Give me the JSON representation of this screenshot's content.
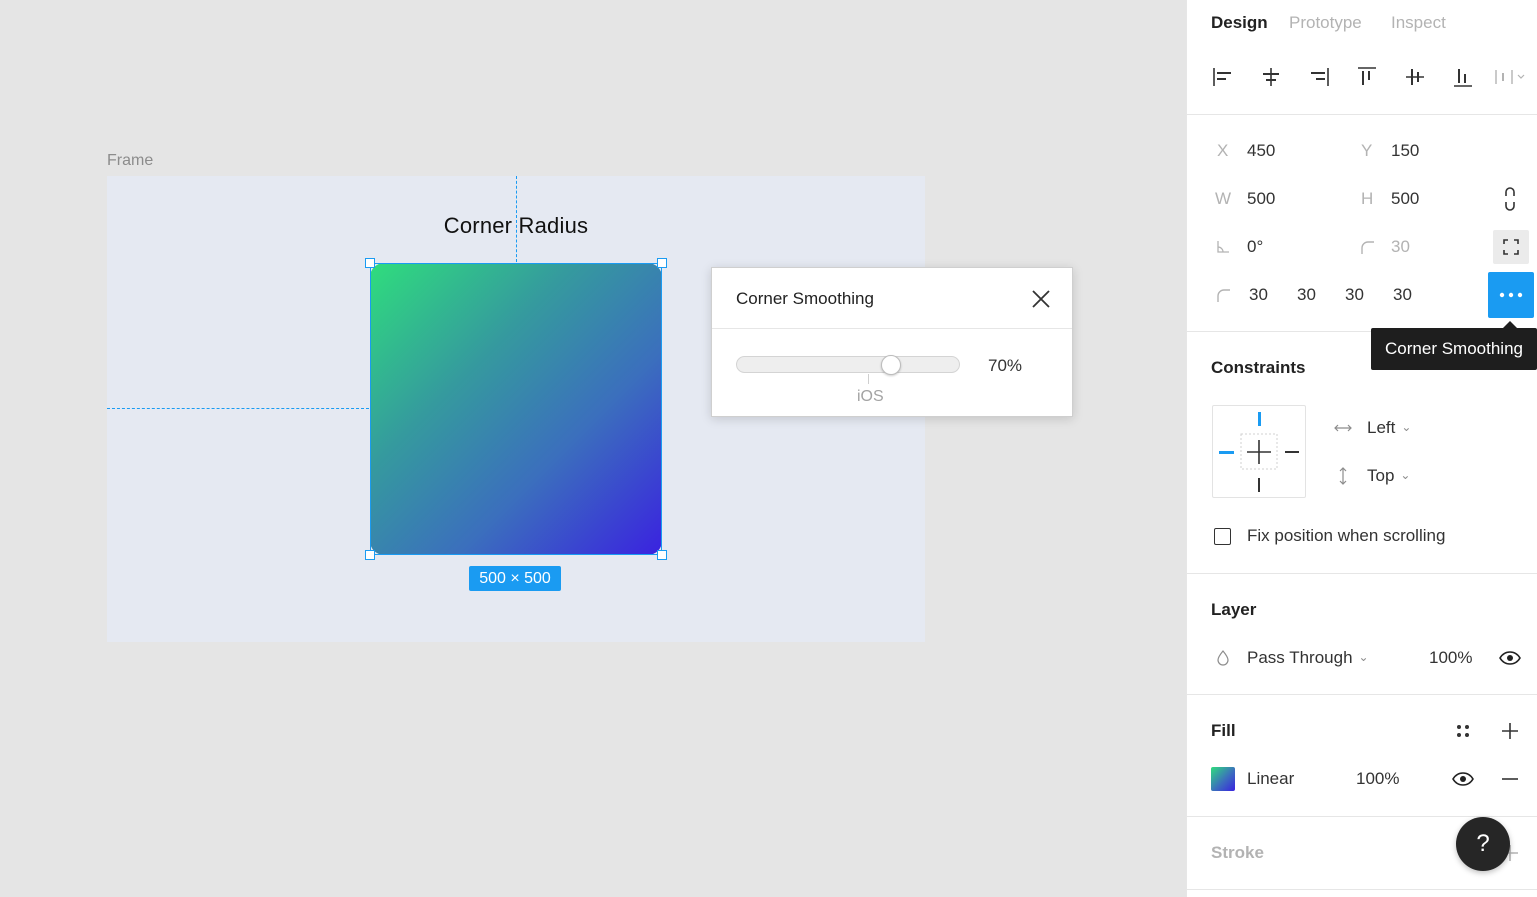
{
  "canvas": {
    "frame_label": "Frame",
    "title": "Corner Radius",
    "size_badge": "500 × 500",
    "fill_gradient": [
      "#2fdd7d",
      "#3a22e0"
    ],
    "selection_color": "#1a9bf2"
  },
  "popup": {
    "title": "Corner Smoothing",
    "value": "70%",
    "value_fraction": 0.7,
    "preset_label": "iOS"
  },
  "panel": {
    "tabs": [
      "Design",
      "Prototype",
      "Inspect"
    ],
    "active_tab": "Design",
    "align_icons": [
      "align-left-icon",
      "align-horizontal-center-icon",
      "align-right-icon",
      "align-top-icon",
      "align-vertical-center-icon",
      "align-bottom-icon",
      "distribute-icon"
    ],
    "x_label": "X",
    "x_value": "450",
    "y_label": "Y",
    "y_value": "150",
    "w_label": "W",
    "w_value": "500",
    "h_label": "H",
    "h_value": "500",
    "rotation": "0°",
    "radius": "30",
    "corners": [
      "30",
      "30",
      "30",
      "30"
    ],
    "tooltip": "Corner Smoothing",
    "constraints": {
      "title": "Constraints",
      "horizontal": "Left",
      "vertical": "Top",
      "fix_label": "Fix position when scrolling",
      "fix_checked": false
    },
    "layer": {
      "title": "Layer",
      "blend": "Pass Through",
      "opacity": "100%"
    },
    "fill": {
      "title": "Fill",
      "type": "Linear",
      "opacity": "100%"
    },
    "stroke": {
      "title": "Stroke"
    },
    "help": "?",
    "accent": "#1a9bf2"
  }
}
